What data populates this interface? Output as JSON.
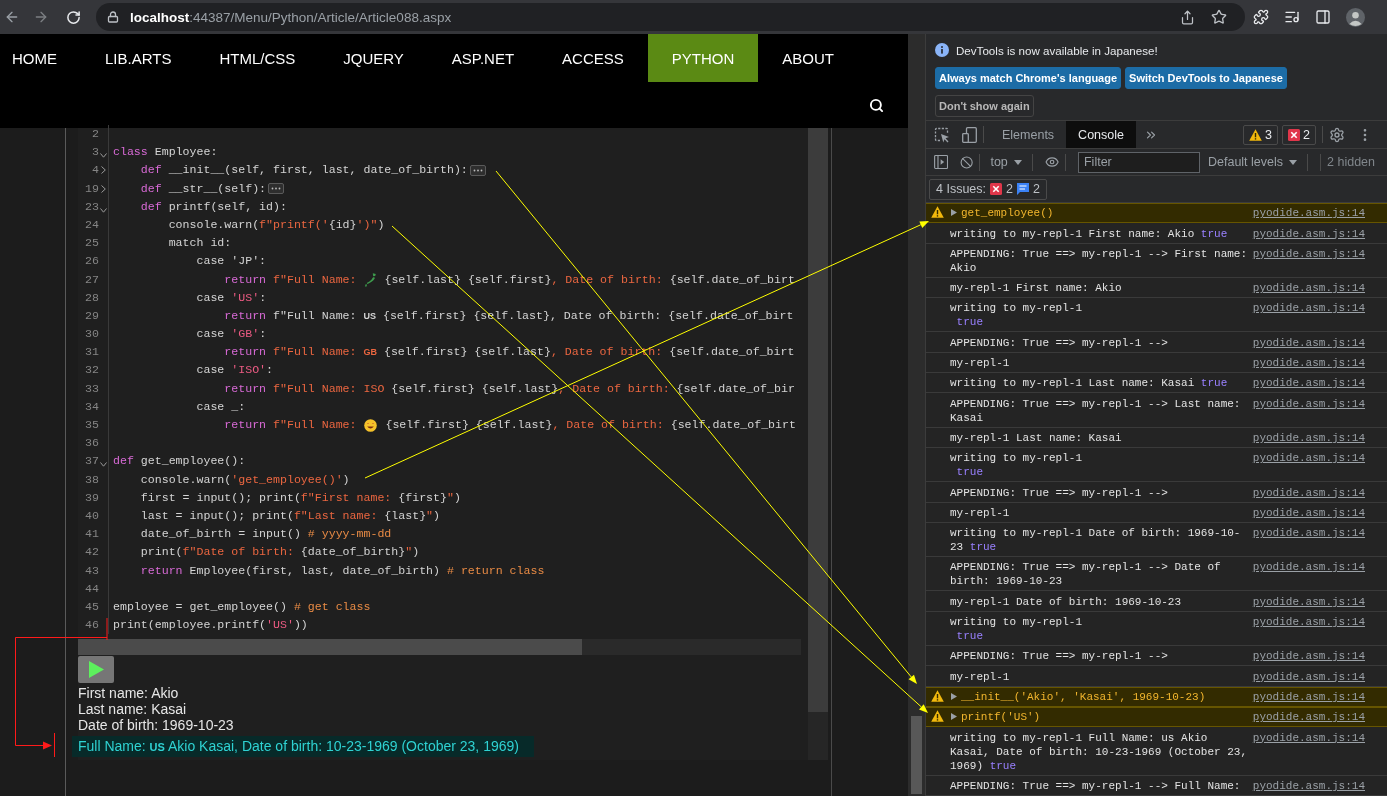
{
  "browser": {
    "url": "**localhost**:44387/Menu/Python/Article/Article088.aspx"
  },
  "nav": {
    "items": [
      {
        "label": "HOME",
        "selected": false
      },
      {
        "label": "LIB.ARTS",
        "selected": false
      },
      {
        "label": "HTML/CSS",
        "selected": false
      },
      {
        "label": "JQUERY",
        "selected": false
      },
      {
        "label": "ASP.NET",
        "selected": false
      },
      {
        "label": "ACCESS",
        "selected": false
      },
      {
        "label": "PYTHON",
        "selected": true
      },
      {
        "label": "ABOUT",
        "selected": false
      }
    ]
  },
  "editor": {
    "lines": [
      {
        "number": "2"
      },
      {
        "number": "3",
        "expanded": true,
        "tokens": [
          {
            "kind": "keyword",
            "text": "class"
          },
          {
            "kind": "plain",
            "text": " Employee:"
          }
        ],
        "children": [
          {
            "number": "4",
            "expanded": false,
            "tokens": [
              {
                "kind": "keyword",
                "text": "def"
              },
              {
                "kind": "plain",
                "text": " __init__(self, first, last, date_of_birth):"
              }
            ]
          },
          {
            "number": "19",
            "expanded": false,
            "tokens": [
              {
                "kind": "keyword",
                "text": "def"
              },
              {
                "kind": "plain",
                "text": " __str__(self):"
              }
            ]
          },
          {
            "number": "23",
            "expanded": true,
            "tokens": [
              {
                "kind": "keyword",
                "text": "def"
              },
              {
                "kind": "plain",
                "text": " printf(self, id):"
              }
            ],
            "children": [
              {
                "number": "24",
                "tokens": [
                  {
                    "kind": "plain",
                    "text": "console.warn("
                  },
                  {
                    "kind": "string",
                    "text": "f\"printf('"
                  },
                  {
                    "kind": "plain",
                    "text": "{id}"
                  },
                  {
                    "kind": "string",
                    "text": "')\""
                  },
                  {
                    "kind": "plain",
                    "text": ")"
                  }
                ]
              },
              {
                "number": "25",
                "tokens": [
                  {
                    "kind": "plain",
                    "text": "match id:"
                  }
                ],
                "children": [
                  {
                    "number": "26",
                    "tokens": [
                      {
                        "kind": "plain",
                        "text": "case 'JP':"
                      }
                    ],
                    "children": [
                      {
                        "number": "27",
                        "tokens": [
                          {
                            "kind": "keyword",
                            "text": "return "
                          },
                          {
                            "kind": "string",
                            "text": "f\"Full Name: "
                          },
                          {
                            "kind": "map"
                          },
                          {
                            "kind": "plain",
                            "text": " {self.last} {self.first}"
                          },
                          {
                            "kind": "string",
                            "text": ", Date of birth: "
                          },
                          {
                            "kind": "plain",
                            "text": "{self.date_of_birt"
                          }
                        ]
                      }
                    ]
                  },
                  {
                    "number": "28",
                    "tokens": [
                      {
                        "kind": "plain",
                        "text": "case "
                      },
                      {
                        "kind": "literal",
                        "text": "'US'"
                      },
                      {
                        "kind": "plain",
                        "text": ":"
                      }
                    ],
                    "children": [
                      {
                        "number": "29",
                        "tokens": [
                          {
                            "kind": "keyword",
                            "text": "return "
                          },
                          {
                            "kind": "plain",
                            "text": "f\"Full Name: "
                          },
                          {
                            "kind": "flag",
                            "text": "US"
                          },
                          {
                            "kind": "plain",
                            "text": " {self.first} {self.last}, Date of birth: {self.date_of_birt"
                          }
                        ]
                      }
                    ]
                  },
                  {
                    "number": "30",
                    "tokens": [
                      {
                        "kind": "plain",
                        "text": "case "
                      },
                      {
                        "kind": "literal",
                        "text": "'GB'"
                      },
                      {
                        "kind": "plain",
                        "text": ":"
                      }
                    ],
                    "children": [
                      {
                        "number": "31",
                        "tokens": [
                          {
                            "kind": "keyword",
                            "text": "return "
                          },
                          {
                            "kind": "string",
                            "text": "f\"Full Name: "
                          },
                          {
                            "kind": "flag",
                            "text": "GB"
                          },
                          {
                            "kind": "plain",
                            "text": " {self.first} {self.last}"
                          },
                          {
                            "kind": "string",
                            "text": ", Date of birth: "
                          },
                          {
                            "kind": "plain",
                            "text": "{self.date_of_birt"
                          }
                        ]
                      }
                    ]
                  },
                  {
                    "number": "32",
                    "tokens": [
                      {
                        "kind": "plain",
                        "text": "case "
                      },
                      {
                        "kind": "literal",
                        "text": "'ISO'"
                      },
                      {
                        "kind": "plain",
                        "text": ":"
                      }
                    ],
                    "children": [
                      {
                        "number": "33",
                        "tokens": [
                          {
                            "kind": "keyword",
                            "text": "return "
                          },
                          {
                            "kind": "string",
                            "text": "f\"Full Name: ISO"
                          },
                          {
                            "kind": "plain",
                            "text": " {self.first} {self.last}"
                          },
                          {
                            "kind": "string",
                            "text": ", Date of birth: "
                          },
                          {
                            "kind": "plain",
                            "text": "{self.date_of_bir"
                          }
                        ]
                      }
                    ]
                  },
                  {
                    "number": "34",
                    "tokens": [
                      {
                        "kind": "plain",
                        "text": "case _:"
                      }
                    ],
                    "children": [
                      {
                        "number": "35",
                        "tokens": [
                          {
                            "kind": "keyword",
                            "text": "return "
                          },
                          {
                            "kind": "string",
                            "text": "f\"Full Name: "
                          },
                          {
                            "kind": "smiley"
                          },
                          {
                            "kind": "plain",
                            "text": " {self.first} {self.last}"
                          },
                          {
                            "kind": "string",
                            "text": ", Date of birth: "
                          },
                          {
                            "kind": "plain",
                            "text": "{self.date_of_birt"
                          }
                        ]
                      }
                    ]
                  }
                ]
              }
            ]
          }
        ]
      },
      {
        "number": "36"
      },
      {
        "number": "37",
        "expanded": true,
        "tokens": [
          {
            "kind": "keyword",
            "text": "def"
          },
          {
            "kind": "plain",
            "text": " get_employee():"
          }
        ],
        "children": [
          {
            "number": "38",
            "tokens": [
              {
                "kind": "plain",
                "text": "console.warn("
              },
              {
                "kind": "string",
                "text": "'get_employee()'"
              },
              {
                "kind": "plain",
                "text": ")"
              }
            ]
          },
          {
            "number": "39",
            "tokens": [
              {
                "kind": "plain",
                "text": "first = input(); print("
              },
              {
                "kind": "string",
                "text": "f\"First name: "
              },
              {
                "kind": "plain",
                "text": "{first}"
              },
              {
                "kind": "string",
                "text": "\""
              },
              {
                "kind": "plain",
                "text": ")"
              }
            ]
          },
          {
            "number": "40",
            "tokens": [
              {
                "kind": "plain",
                "text": "last = input(); print("
              },
              {
                "kind": "string",
                "text": "f\"Last name: "
              },
              {
                "kind": "plain",
                "text": "{last}"
              },
              {
                "kind": "string",
                "text": "\""
              },
              {
                "kind": "plain",
                "text": ")"
              }
            ]
          },
          {
            "number": "41",
            "tokens": [
              {
                "kind": "plain",
                "text": "date_of_birth = input() "
              },
              {
                "kind": "comment",
                "text": "# yyyy-mm-dd"
              }
            ]
          },
          {
            "number": "42",
            "tokens": [
              {
                "kind": "plain",
                "text": "print("
              },
              {
                "kind": "string",
                "text": "f\"Date of birth: "
              },
              {
                "kind": "plain",
                "text": "{date_of_birth}"
              },
              {
                "kind": "string",
                "text": "\""
              },
              {
                "kind": "plain",
                "text": ")"
              }
            ]
          },
          {
            "number": "43",
            "tokens": [
              {
                "kind": "keyword",
                "text": "return"
              },
              {
                "kind": "plain",
                "text": " Employee(first, last, date_of_birth) "
              },
              {
                "kind": "comment",
                "text": "# return class"
              }
            ]
          }
        ]
      },
      {
        "number": "44"
      },
      {
        "number": "45",
        "tokens": [
          {
            "kind": "plain",
            "text": "employee = get_employee() "
          },
          {
            "kind": "comment",
            "text": "# get class"
          }
        ]
      },
      {
        "number": "46",
        "tokens": [
          {
            "kind": "plain",
            "text": "print(employee.printf("
          },
          {
            "kind": "literal",
            "text": "'US'"
          },
          {
            "kind": "plain",
            "text": "))"
          }
        ]
      }
    ]
  },
  "output": {
    "lines": [
      {
        "text": "First name: Akio",
        "highlighted": false
      },
      {
        "text": "Last name: Kasai",
        "highlighted": false
      },
      {
        "text": "Date of birth: 1969-10-23",
        "highlighted": false
      },
      {
        "text": "Full Name: **US** Akio Kasai, Date of birth: 10-23-1969 (October 23, 1969)",
        "highlighted": true
      }
    ]
  },
  "devtools": {
    "banner": {
      "message": "DevTools is now available in Japanese!",
      "buttons": [
        {
          "label": "Always match Chrome's language",
          "kind": "primary"
        },
        {
          "label": "Switch DevTools to Japanese",
          "kind": "primary"
        },
        {
          "label": "Don't show again",
          "kind": "secondary"
        }
      ]
    },
    "tabs": [
      {
        "label": "Elements",
        "selected": false
      },
      {
        "label": "Console",
        "selected": true
      }
    ],
    "warnings": "3",
    "errors": "2",
    "toolbar": {
      "context": "top",
      "filter": {
        "placeholder": "Filter"
      },
      "levels": "Default levels",
      "hidden": "2 hidden"
    },
    "issues": {
      "label": "4 Issues:",
      "errors": "2",
      "infos": "2"
    },
    "messages": [
      {
        "kind": "warning",
        "expanded": false,
        "text": "get_employee()",
        "source": "pyodide.asm.js:14"
      },
      {
        "kind": "log",
        "text": "writing to my-repl-1 First name: Akio",
        "value": "true",
        "source": "pyodide.asm.js:14"
      },
      {
        "kind": "log",
        "text": "APPENDING: True ==> my-repl-1 --> First name: Akio",
        "source": "pyodide.asm.js:14"
      },
      {
        "kind": "log",
        "text": "my-repl-1 First name: Akio",
        "source": "pyodide.asm.js:14"
      },
      {
        "kind": "log",
        "text": "writing to my-repl-1\n",
        "value": "true",
        "source": "pyodide.asm.js:14"
      },
      {
        "kind": "log",
        "text": "APPENDING: True ==> my-repl-1 -->",
        "source": "pyodide.asm.js:14"
      },
      {
        "kind": "log",
        "text": "my-repl-1",
        "source": "pyodide.asm.js:14"
      },
      {
        "kind": "log",
        "text": "writing to my-repl-1 Last name: Kasai",
        "value": "true",
        "source": "pyodide.asm.js:14"
      },
      {
        "kind": "log",
        "text": "APPENDING: True ==> my-repl-1 --> Last name: Kasai",
        "source": "pyodide.asm.js:14"
      },
      {
        "kind": "log",
        "text": "my-repl-1 Last name: Kasai",
        "source": "pyodide.asm.js:14"
      },
      {
        "kind": "log",
        "text": "writing to my-repl-1\n",
        "value": "true",
        "source": "pyodide.asm.js:14"
      },
      {
        "kind": "log",
        "text": "APPENDING: True ==> my-repl-1 -->",
        "source": "pyodide.asm.js:14"
      },
      {
        "kind": "log",
        "text": "my-repl-1",
        "source": "pyodide.asm.js:14"
      },
      {
        "kind": "log",
        "text": "writing to my-repl-1 Date of birth: 1969-10-23",
        "value": "true",
        "source": "pyodide.asm.js:14"
      },
      {
        "kind": "log",
        "text": "APPENDING: True ==> my-repl-1 --> Date of birth: 1969-10-23",
        "source": "pyodide.asm.js:14"
      },
      {
        "kind": "log",
        "text": "my-repl-1 Date of birth: 1969-10-23",
        "source": "pyodide.asm.js:14"
      },
      {
        "kind": "log",
        "text": "writing to my-repl-1\n",
        "value": "true",
        "source": "pyodide.asm.js:14"
      },
      {
        "kind": "log",
        "text": "APPENDING: True ==> my-repl-1 -->",
        "source": "pyodide.asm.js:14"
      },
      {
        "kind": "log",
        "text": "my-repl-1",
        "source": "pyodide.asm.js:14"
      },
      {
        "kind": "warning",
        "expanded": false,
        "text": "__init__('Akio', 'Kasai', 1969-10-23)",
        "source": "pyodide.asm.js:14"
      },
      {
        "kind": "warning",
        "expanded": false,
        "text": "printf('US')",
        "source": "pyodide.asm.js:14"
      },
      {
        "kind": "log",
        "text": "writing to my-repl-1 Full Name: us Akio Kasai, Date of birth: 10-23-1969 (October 23, 1969)",
        "value": "true",
        "source": "pyodide.asm.js:14"
      },
      {
        "kind": "log",
        "text": "APPENDING: True ==> my-repl-1 --> Full Name:",
        "source": "pyodide.asm.js:14"
      }
    ]
  }
}
